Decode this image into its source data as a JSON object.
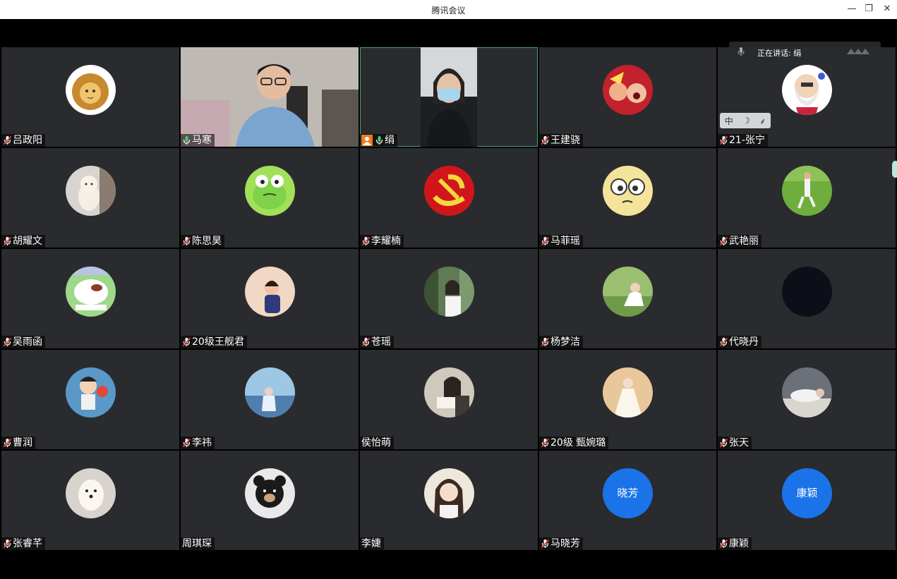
{
  "window": {
    "title": "腾讯会议",
    "minimize": "—",
    "restore": "❐",
    "close": "✕"
  },
  "speaking": {
    "label": "正在讲话: 绢"
  },
  "ime": {
    "lang": "中",
    "moon": "☽",
    "punct": "⸙"
  },
  "colors": {
    "tile": "#2a2b2e",
    "grid": "#000000",
    "accent": "#3fa371",
    "letterAvatar": "#1a73e8"
  },
  "participants": [
    {
      "name": "吕政阳",
      "mic": "muted",
      "avatar": "lion-icon"
    },
    {
      "name": "马寒",
      "mic": "on",
      "avatar": "video"
    },
    {
      "name": "绢",
      "mic": "on",
      "avatar": "video",
      "host": true,
      "active": true
    },
    {
      "name": "王建骁",
      "mic": "muted",
      "avatar": "red-cartoon-icon"
    },
    {
      "name": "21-张宁",
      "mic": "muted",
      "avatar": "marx-cartoon-icon"
    },
    {
      "name": "胡耀文",
      "mic": "muted",
      "avatar": "kitten-icon"
    },
    {
      "name": "陈思昊",
      "mic": "muted",
      "avatar": "frog-icon"
    },
    {
      "name": "李耀楠",
      "mic": "muted",
      "avatar": "party-emblem-icon"
    },
    {
      "name": "马菲瑶",
      "mic": "muted",
      "avatar": "cartoon-face-icon"
    },
    {
      "name": "武艳丽",
      "mic": "muted",
      "avatar": "grass-field-icon"
    },
    {
      "name": "吴雨函",
      "mic": "muted",
      "avatar": "white-cat-icon"
    },
    {
      "name": "20级王舰君",
      "mic": "muted",
      "avatar": "child-photo-icon"
    },
    {
      "name": "苍瑶",
      "mic": "muted",
      "avatar": "girl-trees-icon"
    },
    {
      "name": "杨梦洁",
      "mic": "muted",
      "avatar": "garden-girl-icon"
    },
    {
      "name": "代晓丹",
      "mic": "muted",
      "avatar": "dark-icon"
    },
    {
      "name": "曹润",
      "mic": "muted",
      "avatar": "basketball-boy-icon"
    },
    {
      "name": "李祎",
      "mic": "muted",
      "avatar": "seaside-girl-icon"
    },
    {
      "name": "侯怡萌",
      "mic": "none",
      "avatar": "reading-girl-icon"
    },
    {
      "name": "20级 甄婉璐",
      "mic": "muted",
      "avatar": "bride-icon"
    },
    {
      "name": "张天",
      "mic": "muted",
      "avatar": "lying-figure-icon"
    },
    {
      "name": "张睿芊",
      "mic": "muted",
      "avatar": "puppy-icon"
    },
    {
      "name": "周琪琛",
      "mic": "none",
      "avatar": "bear-icon"
    },
    {
      "name": "李婕",
      "mic": "none",
      "avatar": "girl-portrait-icon"
    },
    {
      "name": "马晓芳",
      "mic": "muted",
      "avatar": "letter",
      "letter": "晓芳"
    },
    {
      "name": "康颖",
      "mic": "muted",
      "avatar": "letter",
      "letter": "康颖"
    }
  ]
}
